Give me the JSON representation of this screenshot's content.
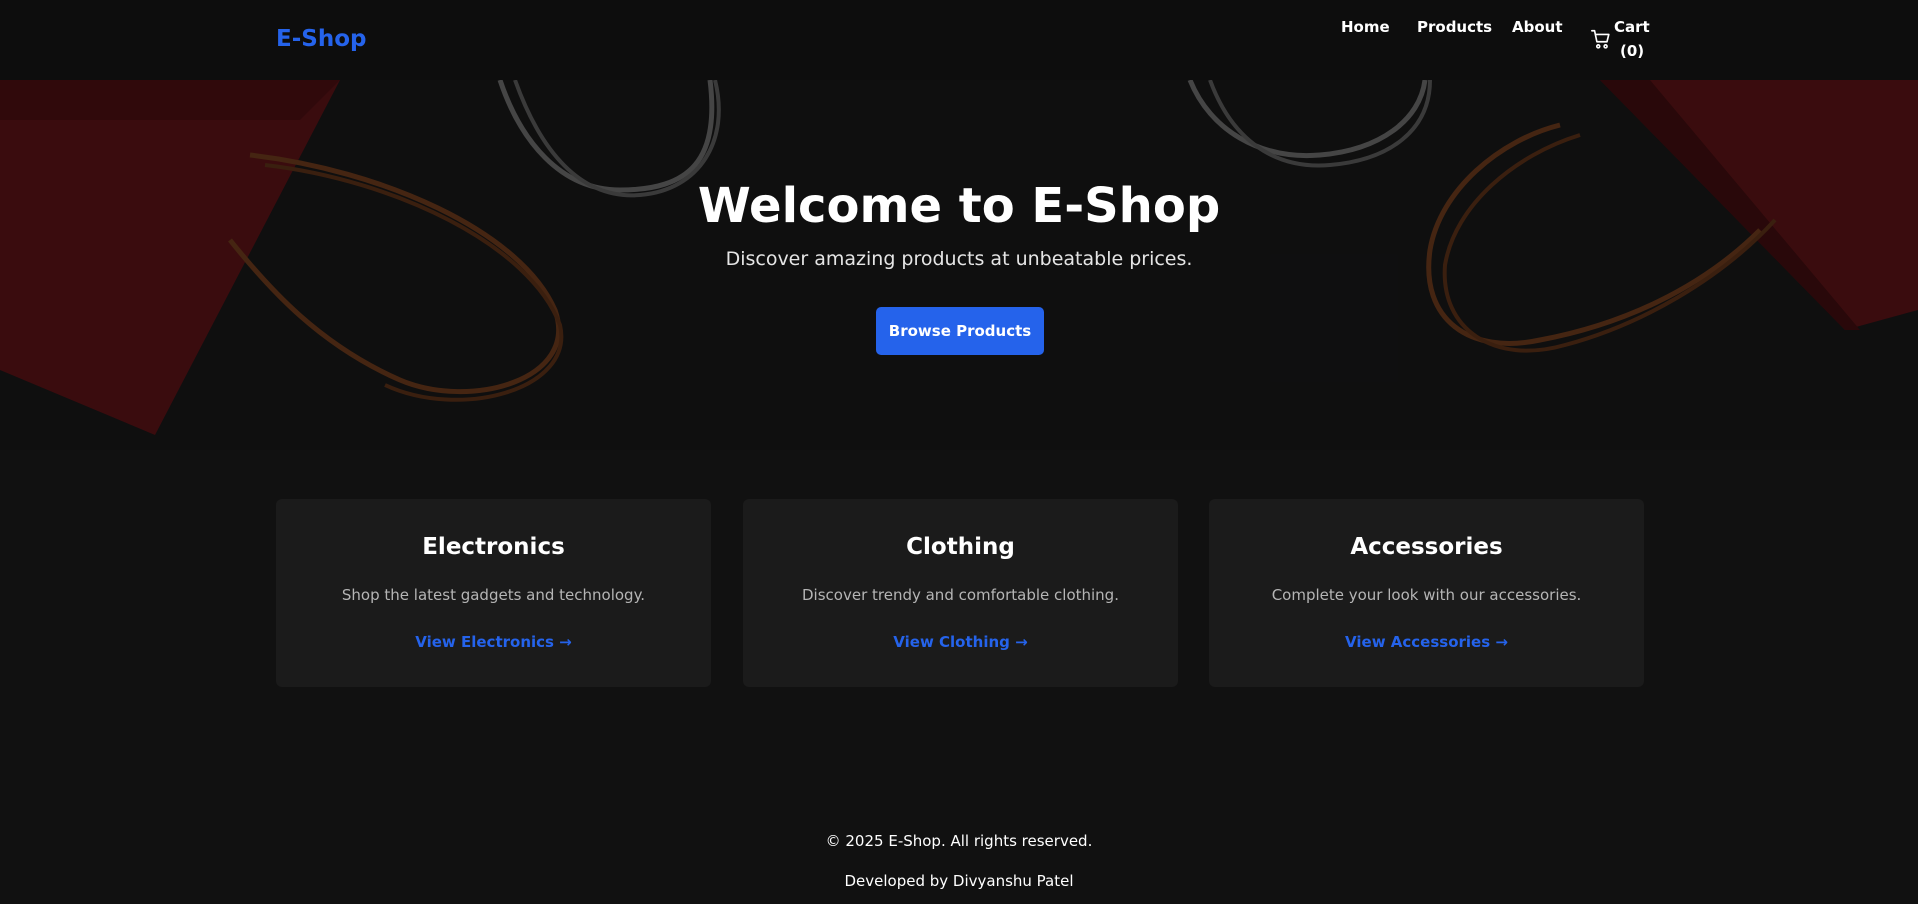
{
  "header": {
    "logo": "E-Shop",
    "nav": [
      {
        "label": "Home"
      },
      {
        "label": "Products"
      },
      {
        "label": "About"
      }
    ],
    "cart": {
      "label": "Cart",
      "count": "(0)",
      "icon": "cart-icon"
    }
  },
  "hero": {
    "title": "Welcome to E-Shop",
    "subtitle": "Discover amazing products at unbeatable prices.",
    "button_label": "Browse Products"
  },
  "categories": [
    {
      "title": "Electronics",
      "description": "Shop the latest gadgets and technology.",
      "link": "View Electronics →"
    },
    {
      "title": "Clothing",
      "description": "Discover trendy and comfortable clothing.",
      "link": "View Clothing →"
    },
    {
      "title": "Accessories",
      "description": "Complete your look with our accessories.",
      "link": "View Accessories →"
    }
  ],
  "footer": {
    "copyright": "© 2025 E-Shop. All rights reserved.",
    "developer": "Developed by Divyanshu Patel"
  },
  "colors": {
    "accent": "#2563eb",
    "background": "#111111",
    "header": "#0d0d0d",
    "card": "#1b1b1b",
    "bag_red": "#6e1518"
  }
}
